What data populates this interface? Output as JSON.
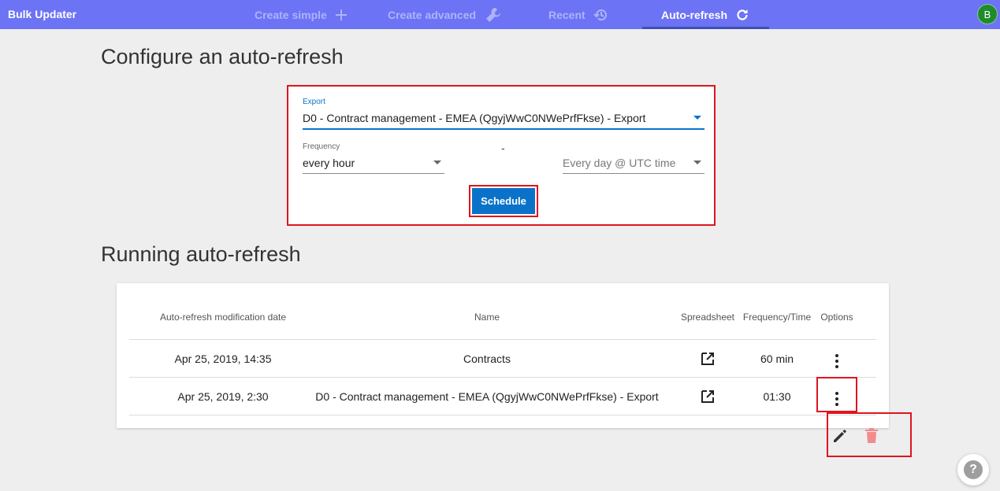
{
  "app": {
    "title": "Bulk Updater",
    "avatar_letter": "B",
    "accent": "#6c73f5",
    "avatar_color": "#1e8c2c"
  },
  "nav": {
    "tabs": [
      {
        "label": "Create simple",
        "icon": "plus-icon",
        "active": false
      },
      {
        "label": "Create advanced",
        "icon": "wrench-icon",
        "active": false
      },
      {
        "label": "Recent",
        "icon": "history-icon",
        "active": false
      },
      {
        "label": "Auto-refresh",
        "icon": "refresh-icon",
        "active": true
      }
    ]
  },
  "configure": {
    "heading": "Configure an auto-refresh",
    "export_label": "Export",
    "export_value": "D0 - Contract management - EMEA (QgyjWwC0NWePrfFkse) - Export",
    "frequency_label": "Frequency",
    "frequency_value": "every hour",
    "separator": "-",
    "time_placeholder": "Every day @ UTC time",
    "schedule_label": "Schedule",
    "button_color": "#0a73c9",
    "highlight_color": "#e0141e"
  },
  "running": {
    "heading": "Running auto-refresh",
    "columns": [
      "Auto-refresh modification date",
      "Name",
      "Spreadsheet",
      "Frequency/Time",
      "Options"
    ],
    "rows": [
      {
        "date": "Apr 25, 2019, 14:35",
        "name": "Contracts",
        "frequency": "60 min"
      },
      {
        "date": "Apr 25, 2019, 2:30",
        "name": "D0 - Contract management - EMEA (QgyjWwC0NWePrfFkse) - Export",
        "frequency": "01:30"
      }
    ],
    "row_actions": [
      {
        "icon": "pencil-icon",
        "color": "#333333"
      },
      {
        "icon": "trash-icon",
        "color": "#f28b8b"
      }
    ]
  },
  "help": {
    "label": "?"
  }
}
